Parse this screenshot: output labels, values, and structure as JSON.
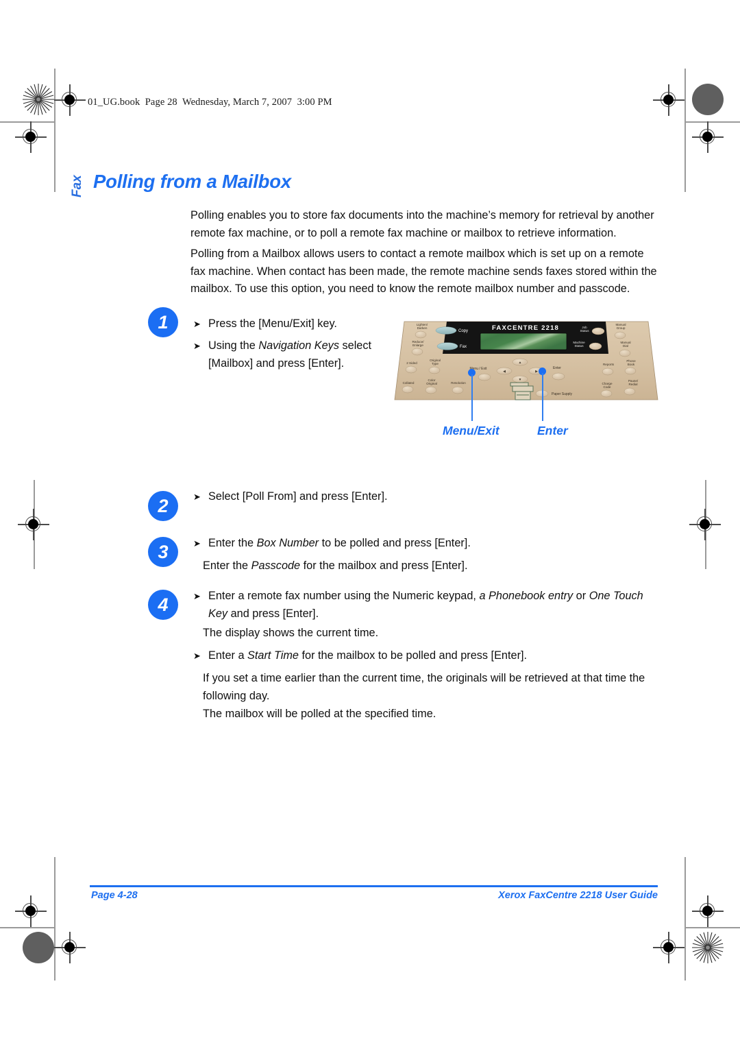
{
  "header": {
    "slug": "01_UG.book  Page 28  Wednesday, March 7, 2007  3:00 PM"
  },
  "chapter": {
    "tab_label": "Fax",
    "title": "Polling from a Mailbox"
  },
  "intro": {
    "paragraph_1": "Polling enables you to store fax documents into the machine’s memory for retrieval by another remote fax machine, or to poll a remote fax machine or mailbox to retrieve information.",
    "paragraph_2": "Polling from a Mailbox allows users to contact a remote mailbox which is set up on a remote fax machine. When contact has been made, the remote machine sends faxes stored within the mailbox. To use this option, you need to know the remote mailbox number and passcode."
  },
  "steps": [
    {
      "number": "1",
      "lines": [
        {
          "bullet": true,
          "text": "Press the [Menu/Exit] key."
        },
        {
          "bullet": true,
          "text": "Using the Navigation Keys select [Mailbox] and press [Enter]."
        }
      ]
    },
    {
      "number": "2",
      "lines": [
        {
          "bullet": true,
          "text": "Select [Poll From] and press [Enter]."
        }
      ]
    },
    {
      "number": "3",
      "lines": [
        {
          "bullet": true,
          "text": "Enter the Box Number to be polled and press [Enter]."
        },
        {
          "bullet": false,
          "text": "Enter the Passcode for the mailbox and press [Enter]."
        }
      ]
    },
    {
      "number": "4",
      "lines": [
        {
          "bullet": true,
          "text": "Enter a remote fax number using the Numeric keypad, a Phonebook entry or One Touch Key and press [Enter]."
        },
        {
          "bullet": false,
          "text": "The display shows the current time."
        },
        {
          "bullet": true,
          "text": "Enter a Start Time for the mailbox to be polled and press [Enter]."
        }
      ]
    }
  ],
  "notes": {
    "paragraph_1": "If you set a time earlier than the current time, the originals will be retrieved at that time the following day.",
    "paragraph_2": "The mailbox will be polled at the specified time."
  },
  "illustration": {
    "model_name": "FAXCENTRE 2218",
    "lcd_color": "#3f7a46",
    "panel_color": "#d9c5a8",
    "dark_panel_color": "#141414",
    "left_buttons": [
      "Lighten/\nDarken",
      "Reduce/\nEnlarge",
      "2 Sided",
      "Original\nType",
      "Collated",
      "Color\nOriginal",
      "Resolution"
    ],
    "mode_buttons": [
      "Copy",
      "Fax"
    ],
    "right_buttons": [
      "Job\nStatus",
      "Machine\nStatus",
      "Manual\nGroup",
      "Manual\nDial",
      "Reports",
      "Phone\nBook",
      "Charge\nCode",
      "Pause/\nRedial"
    ],
    "nav_center_label": "Menu / Exit",
    "nav_enter_label": "Enter",
    "paper_supply_label": "Paper Supply",
    "arrow_glyphs": [
      "▲",
      "◀",
      "▶",
      "▼"
    ]
  },
  "callouts": [
    {
      "label": "Menu/Exit"
    },
    {
      "label": "Enter"
    }
  ],
  "footer": {
    "page_label": "Page 4-28",
    "guide_label": "Xerox FaxCentre 2218 User Guide"
  },
  "colors": {
    "accent_blue": "#1d6ff0",
    "text_black": "#101010"
  }
}
